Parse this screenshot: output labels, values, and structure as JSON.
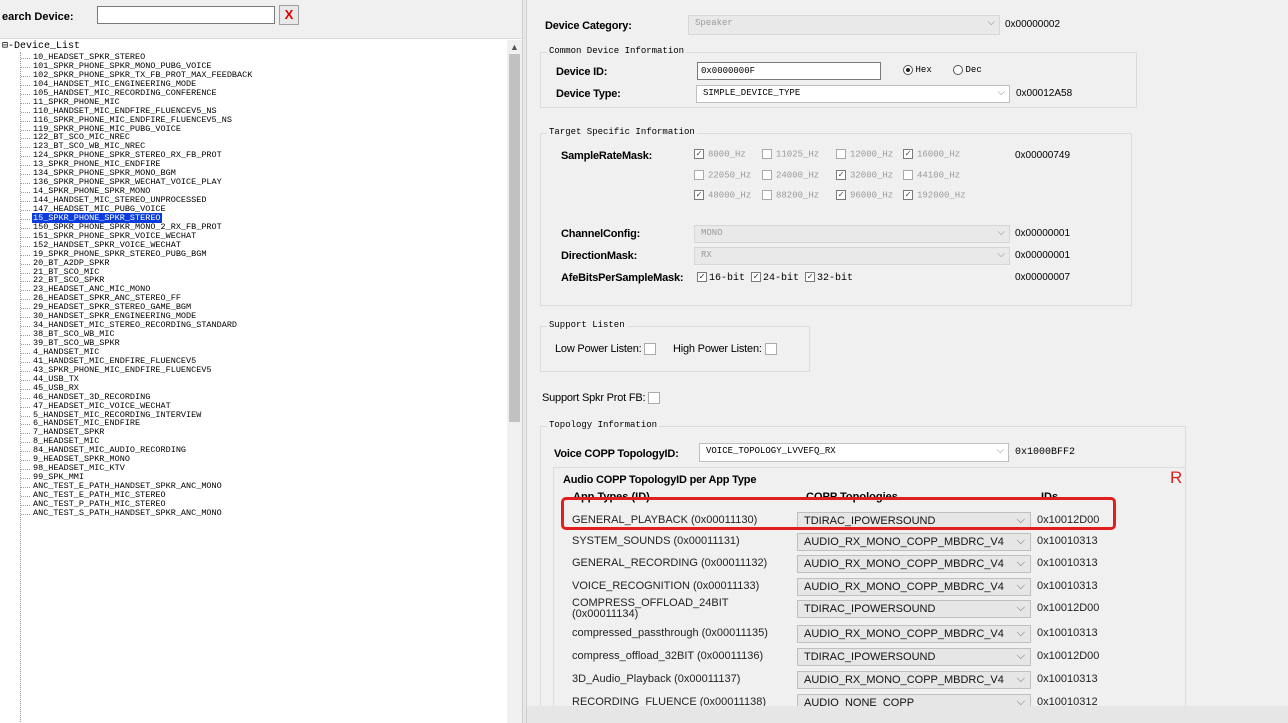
{
  "search": {
    "label": "earch Device:",
    "value": "",
    "clear_label": "X"
  },
  "tree": {
    "root_label": "Device_List",
    "items": [
      "10_HEADSET_SPKR_STEREO",
      "101_SPKR_PHONE_SPKR_MONO_PUBG_VOICE",
      "102_SPKR_PHONE_SPKR_TX_FB_PROT_MAX_FEEDBACK",
      "104_HANDSET_MIC_ENGINEERING_MODE",
      "105_HANDSET_MIC_RECORDING_CONFERENCE",
      "11_SPKR_PHONE_MIC",
      "110_HANDSET_MIC_ENDFIRE_FLUENCEV5_NS",
      "116_SPKR_PHONE_MIC_ENDFIRE_FLUENCEV5_NS",
      "119_SPKR_PHONE_MIC_PUBG_VOICE",
      "122_BT_SCO_MIC_NREC",
      "123_BT_SCO_WB_MIC_NREC",
      "124_SPKR_PHONE_SPKR_STEREO_RX_FB_PROT",
      "13_SPKR_PHONE_MIC_ENDFIRE",
      "134_SPKR_PHONE_SPKR_MONO_BGM",
      "136_SPKR_PHONE_SPKR_WECHAT_VOICE_PLAY",
      "14_SPKR_PHONE_SPKR_MONO",
      "144_HANDSET_MIC_STEREO_UNPROCESSED",
      "147_HEADSET_MIC_PUBG_VOICE",
      "15_SPKR_PHONE_SPKR_STEREO",
      "150_SPKR_PHONE_SPKR_MONO_2_RX_FB_PROT",
      "151_SPKR_PHONE_SPKR_VOICE_WECHAT",
      "152_HANDSET_SPKR_VOICE_WECHAT",
      "19_SPKR_PHONE_SPKR_STEREO_PUBG_BGM",
      "20_BT_A2DP_SPKR",
      "21_BT_SCO_MIC",
      "22_BT_SCO_SPKR",
      "23_HEADSET_ANC_MIC_MONO",
      "26_HEADSET_SPKR_ANC_STEREO_FF",
      "29_HEADSET_SPKR_STEREO_GAME_BGM",
      "30_HANDSET_SPKR_ENGINEERING_MODE",
      "34_HANDSET_MIC_STEREO_RECORDING_STANDARD",
      "38_BT_SCO_WB_MIC",
      "39_BT_SCO_WB_SPKR",
      "4_HANDSET_MIC",
      "41_HANDSET_MIC_ENDFIRE_FLUENCEV5",
      "43_SPKR_PHONE_MIC_ENDFIRE_FLUENCEV5",
      "44_USB_TX",
      "45_USB_RX",
      "46_HANDSET_3D_RECORDING",
      "47_HEADSET_MIC_VOICE_WECHAT",
      "5_HANDSET_MIC_RECORDING_INTERVIEW",
      "6_HANDSET_MIC_ENDFIRE",
      "7_HANDSET_SPKR",
      "8_HEADSET_MIC",
      "84_HANDSET_MIC_AUDIO_RECORDING",
      "9_HEADSET_SPKR_MONO",
      "98_HEADSET_MIC_KTV",
      "99_SPK_MMI",
      "ANC_TEST_E_PATH_HANDSET_SPKR_ANC_MONO",
      "ANC_TEST_E_PATH_MIC_STEREO",
      "ANC_TEST_P_PATH_MIC_STEREO",
      "ANC_TEST_S_PATH_HANDSET_SPKR_ANC_MONO"
    ],
    "selected_index": 18
  },
  "device": {
    "category_label": "Device Category:",
    "category_value": "Speaker",
    "category_hex": "0x00000002",
    "common_group_title": "Common Device Information",
    "id_label": "Device ID:",
    "id_value": "0x0000000F",
    "hex_label": "Hex",
    "dec_label": "Dec",
    "type_label": "Device Type:",
    "type_value": "SIMPLE_DEVICE_TYPE",
    "type_hex": "0x00012A58"
  },
  "target": {
    "group_title": "Target Specific Information",
    "samplerate_label": "SampleRateMask:",
    "samplerate_hex": "0x00000749",
    "rates": [
      {
        "label": "8000_Hz",
        "checked": true
      },
      {
        "label": "11025_Hz",
        "checked": false
      },
      {
        "label": "12000_Hz",
        "checked": false
      },
      {
        "label": "16000_Hz",
        "checked": true
      },
      {
        "label": "22050_Hz",
        "checked": false
      },
      {
        "label": "24000_Hz",
        "checked": false
      },
      {
        "label": "32000_Hz",
        "checked": true
      },
      {
        "label": "44100_Hz",
        "checked": false
      },
      {
        "label": "48000_Hz",
        "checked": true
      },
      {
        "label": "88200_Hz",
        "checked": false
      },
      {
        "label": "96000_Hz",
        "checked": true
      },
      {
        "label": "192000_Hz",
        "checked": true
      }
    ],
    "channel_label": "ChannelConfig:",
    "channel_value": "MONO",
    "channel_hex": "0x00000001",
    "direction_label": "DirectionMask:",
    "direction_value": "RX",
    "direction_hex": "0x00000001",
    "afebits_label": "AfeBitsPerSampleMask:",
    "afebits_options": [
      "16-bit",
      "24-bit",
      "32-bit"
    ],
    "afebits_hex": "0x00000007"
  },
  "listen": {
    "group_title": "Support Listen",
    "low_label": "Low Power Listen:",
    "high_label": "High Power Listen:"
  },
  "spkr_prot_label": "Support Spkr Prot FB:",
  "topology": {
    "group_title": "Topology Information",
    "voice_label": "Voice COPP TopologyID:",
    "voice_value": "VOICE_TOPOLOGY_LVVEFQ_RX",
    "voice_hex": "0x1000BFF2",
    "audio_group_title": "Audio COPP TopologyID per App Type",
    "col_app": "App Types (ID)",
    "col_copp": "COPP Topologies",
    "col_ids": "IDs",
    "rows": [
      {
        "app": "GENERAL_PLAYBACK (0x00011130)",
        "copp": "TDIRAC_IPOWERSOUND",
        "id": "0x10012D00"
      },
      {
        "app": "SYSTEM_SOUNDS (0x00011131)",
        "copp": "AUDIO_RX_MONO_COPP_MBDRC_V4",
        "id": "0x10010313"
      },
      {
        "app": "GENERAL_RECORDING (0x00011132)",
        "copp": "AUDIO_RX_MONO_COPP_MBDRC_V4",
        "id": "0x10010313"
      },
      {
        "app": "VOICE_RECOGNITION (0x00011133)",
        "copp": "AUDIO_RX_MONO_COPP_MBDRC_V4",
        "id": "0x10010313"
      },
      {
        "app": "COMPRESS_OFFLOAD_24BIT (0x00011134)",
        "copp": "TDIRAC_IPOWERSOUND",
        "id": "0x10012D00"
      },
      {
        "app": "compressed_passthrough (0x00011135)",
        "copp": "AUDIO_RX_MONO_COPP_MBDRC_V4",
        "id": "0x10010313"
      },
      {
        "app": "compress_offload_32BIT (0x00011136)",
        "copp": "TDIRAC_IPOWERSOUND",
        "id": "0x10012D00"
      },
      {
        "app": "3D_Audio_Playback (0x00011137)",
        "copp": "AUDIO_RX_MONO_COPP_MBDRC_V4",
        "id": "0x10010313"
      },
      {
        "app": "RECORDING_FLUENCE (0x00011138)",
        "copp": "AUDIO_NONE_COPP",
        "id": "0x10010312"
      }
    ]
  },
  "annotation": {
    "text": "R",
    "color": "#e01f1f"
  },
  "colors": {
    "selection": "#0a3cdf",
    "highlight": "#e01f1f"
  }
}
